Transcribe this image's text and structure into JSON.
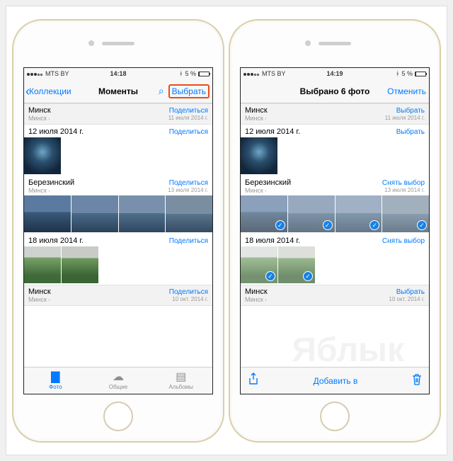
{
  "statusbar": {
    "carrier": "MTS BY",
    "time_left": "14:18",
    "time_right": "14:19",
    "battery_text": "5 %",
    "bt_icon": "bluetooth-icon"
  },
  "left": {
    "nav": {
      "back": "Коллекции",
      "title": "Моменты",
      "select": "Выбрать"
    },
    "sections": [
      {
        "title": "Минск",
        "sub": "Минск",
        "action": "Поделиться",
        "date": "11 июля 2014 г."
      },
      {
        "title": "12 июля 2014 г.",
        "action": "Поделиться"
      },
      {
        "title": "Березинский",
        "sub": "Минск",
        "action": "Поделиться",
        "date": "13 июля 2014 г."
      },
      {
        "title": "18 июля 2014 г.",
        "action": "Поделиться"
      },
      {
        "title": "Минск",
        "sub": "Минск",
        "action": "Поделиться",
        "date": "10 окт. 2014 г."
      }
    ],
    "tabs": {
      "photos": "Фото",
      "shared": "Общие",
      "albums": "Альбомы"
    }
  },
  "right": {
    "nav": {
      "title": "Выбрано 6 фото",
      "cancel": "Отменить"
    },
    "sections": [
      {
        "title": "Минск",
        "sub": "Минск",
        "action": "Выбрать",
        "date": "11 июля 2014 г."
      },
      {
        "title": "12 июля 2014 г.",
        "action": "Выбрать"
      },
      {
        "title": "Березинский",
        "sub": "Минск",
        "action": "Снять выбор",
        "date": "13 июля 2014 г."
      },
      {
        "title": "18 июля 2014 г.",
        "action": "Снять выбор"
      },
      {
        "title": "Минск",
        "sub": "Минск",
        "action": "Выбрать",
        "date": "10 окт. 2014 г."
      }
    ],
    "actionbar": {
      "add_to": "Добавить в"
    }
  },
  "watermark": "Яблык",
  "icons": {
    "back_chevron": "‹",
    "tiny_arrow": "›",
    "search": "⌕",
    "bluetooth": "ᚼ",
    "share": "⇧",
    "trash": "🗑",
    "photos": "▇",
    "cloud": "☁",
    "albums": "▤",
    "check": "✓"
  }
}
